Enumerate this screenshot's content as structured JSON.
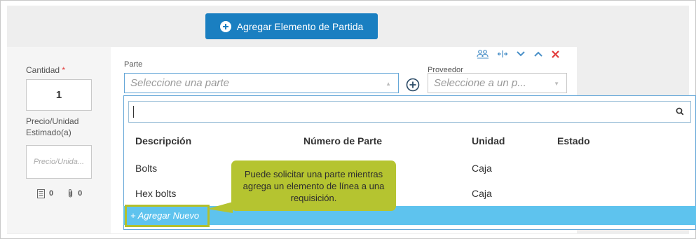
{
  "toolbar": {
    "add_label": "Agregar Elemento de Partida"
  },
  "left": {
    "qty_label": "Cantidad",
    "qty_required": "*",
    "qty_value": "1",
    "price_label_1": "Precio/Unidad",
    "price_label_2": "Estimado(a)",
    "price_placeholder": "Precio/Unida...",
    "notes_count": "0",
    "attachments_count": "0"
  },
  "part": {
    "label": "Parte",
    "placeholder": "Seleccione una parte"
  },
  "supplier": {
    "label": "Proveedor",
    "placeholder": "Seleccione a un p..."
  },
  "dropdown": {
    "search_value": "",
    "columns": [
      "Descripción",
      "Número de Parte",
      "Unidad",
      "Estado"
    ],
    "rows": [
      {
        "desc": "Bolts",
        "unit": "Caja"
      },
      {
        "desc": "Hex bolts",
        "unit": "Caja"
      }
    ],
    "add_new": "+ Agregar Nuevo"
  },
  "callout": {
    "text": "Puede solicitar una parte mientras agrega un elemento de línea a una requisición."
  },
  "colors": {
    "primary": "#1a7fc1",
    "highlight": "#b5c430",
    "select_bar": "#5ec3ee",
    "close": "#e23b3b"
  }
}
